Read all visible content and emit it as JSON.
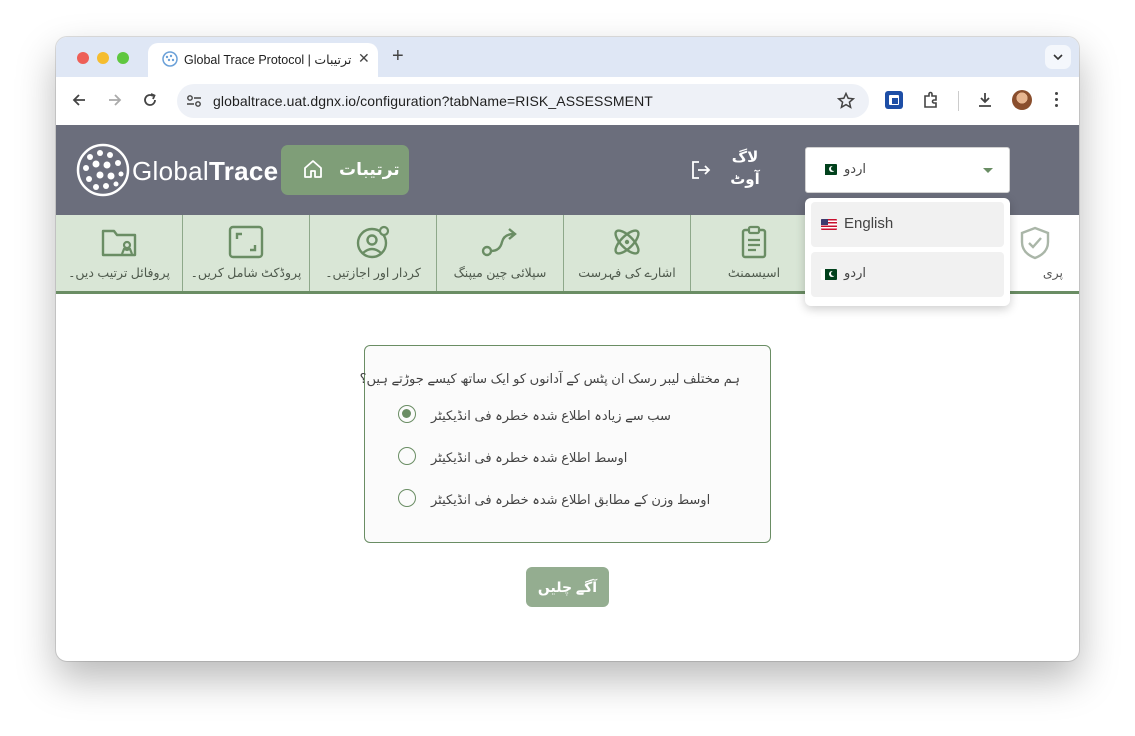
{
  "browser": {
    "tab_title": "Global Trace Protocol | ترتیبات",
    "url": "globaltrace.uat.dgnx.io/configuration?tabName=RISK_ASSESSMENT"
  },
  "header": {
    "logo_text_light": "Global",
    "logo_text_bold": "Trace",
    "settings_label": "ترتیبات",
    "logout_label": "لاگ آوٹ",
    "language_selected": "اردو"
  },
  "nav": {
    "items": [
      {
        "label": "پروفائل ترتیب دیں۔",
        "icon": "folder-user-icon"
      },
      {
        "label": "پروڈکٹ شامل کریں۔",
        "icon": "expand-frame-icon"
      },
      {
        "label": "کردار اور اجازتیں۔",
        "icon": "user-gear-icon"
      },
      {
        "label": "سپلائی چین میپنگ",
        "icon": "route-icon"
      },
      {
        "label": "اشارے کی فہرست",
        "icon": "atom-icon"
      },
      {
        "label": "اسیسمنٹ",
        "icon": "clipboard-icon"
      },
      {
        "label": "پری",
        "icon": "shield-check-icon"
      }
    ]
  },
  "question": {
    "text": "ہم مختلف لیبر رسک ان پٹس کے آدانوں کو ایک ساتھ کیسے جوڑتے ہیں؟",
    "options": [
      {
        "label": "سب سے زیادہ اطلاع شدہ خطرہ فی انڈیکیٹر",
        "selected": true
      },
      {
        "label": "اوسط اطلاع شدہ خطرہ فی انڈیکیٹر",
        "selected": false
      },
      {
        "label": "اوسط وزن کے مطابق اطلاع شدہ خطرہ فی انڈیکیٹر",
        "selected": false
      }
    ],
    "next_label": "آگے چلیں"
  },
  "language_dropdown": {
    "options": [
      {
        "label": "English",
        "flag": "us-flag-icon"
      },
      {
        "label": "اردو",
        "flag": "pk-flag-icon"
      }
    ]
  },
  "colors": {
    "header_bg": "#6b6e7c",
    "accent_green": "#7f9e78",
    "nav_bg": "#d9e6d6"
  }
}
